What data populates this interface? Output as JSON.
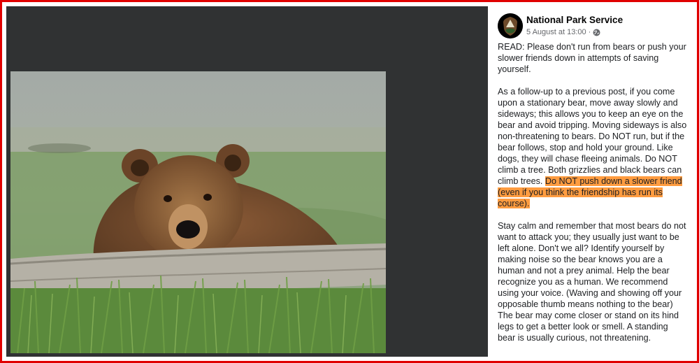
{
  "post": {
    "author": "National Park Service",
    "timestamp": "5 August at 13:00",
    "separator": "·",
    "privacy_icon": "globe-icon",
    "avatar_icon": "nps-arrowhead-logo",
    "paragraph1": "READ: Please don't run from bears or push your slower friends down in attempts of saving yourself.",
    "paragraph2_before": "As a follow-up to a previous post, if you come upon a stationary bear, move away slowly and sideways; this allows you to keep an eye on the bear and avoid tripping. Moving sideways is also non-threatening to bears. Do NOT run, but if the bear follows, stop and hold your ground. Like dogs, they will chase fleeing animals. Do NOT climb a tree. Both grizzlies and black bears can climb trees. ",
    "paragraph2_highlight": "Do NOT push down a slower friend (even if you think the friendship has run its course).",
    "paragraph3": "Stay calm and remember that most bears do not want to attack you; they usually just want to be left alone. Don't we all? Identify yourself by making noise so the bear knows you are a human and not a prey animal. Help the bear recognize you as a human. We recommend using your voice. (Waving and showing off your opposable thumb means nothing to the bear) The bear may come closer or stand on its hind legs to get a better look or smell. A standing bear is usually curious, not threatening."
  },
  "colors": {
    "highlight": "#ff9c40",
    "border": "#e00000",
    "viewer_bg": "#303233"
  }
}
